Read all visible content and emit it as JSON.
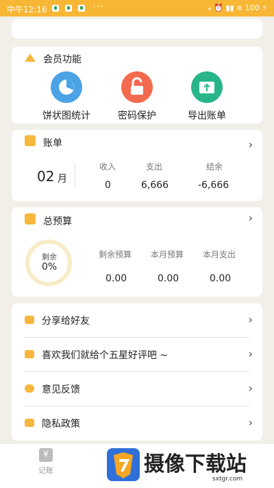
{
  "status_bar": {
    "time": "中午12:16",
    "dots": "···",
    "right": "⁎ ⏰ ▮▮ ≋ 100 ⚡"
  },
  "vip": {
    "title": "会员功能",
    "features": [
      {
        "label": "饼状图统计",
        "icon": "pie-chart-icon",
        "color": "#4ba3e6"
      },
      {
        "label": "密码保护",
        "icon": "lock-icon",
        "color": "#f46a4e"
      },
      {
        "label": "导出账单",
        "icon": "export-icon",
        "color": "#28b58a"
      }
    ]
  },
  "bill": {
    "title": "账单",
    "month_num": "02",
    "month_unit": "月",
    "headers": [
      "收入",
      "支出",
      "结余"
    ],
    "values": [
      "0",
      "6,666",
      "-6,666"
    ]
  },
  "budget": {
    "title": "总预算",
    "ring_label": "剩余",
    "ring_percent": "0%",
    "headers": [
      "剩余预算",
      "本月预算",
      "本月支出"
    ],
    "values": [
      "0.00",
      "0.00",
      "0.00"
    ]
  },
  "menu": [
    {
      "label": "分享给好友",
      "icon": "share-icon"
    },
    {
      "label": "喜欢我们就给个五星好评吧 ~",
      "icon": "thumbs-up-icon"
    },
    {
      "label": "意见反馈",
      "icon": "feedback-icon"
    },
    {
      "label": "隐私政策",
      "icon": "shield-icon"
    }
  ],
  "tabbar": {
    "tab1_label": "记账"
  },
  "watermark": {
    "brand": "摄像下载站",
    "url": "sxtgr.com"
  },
  "chevron": "›"
}
